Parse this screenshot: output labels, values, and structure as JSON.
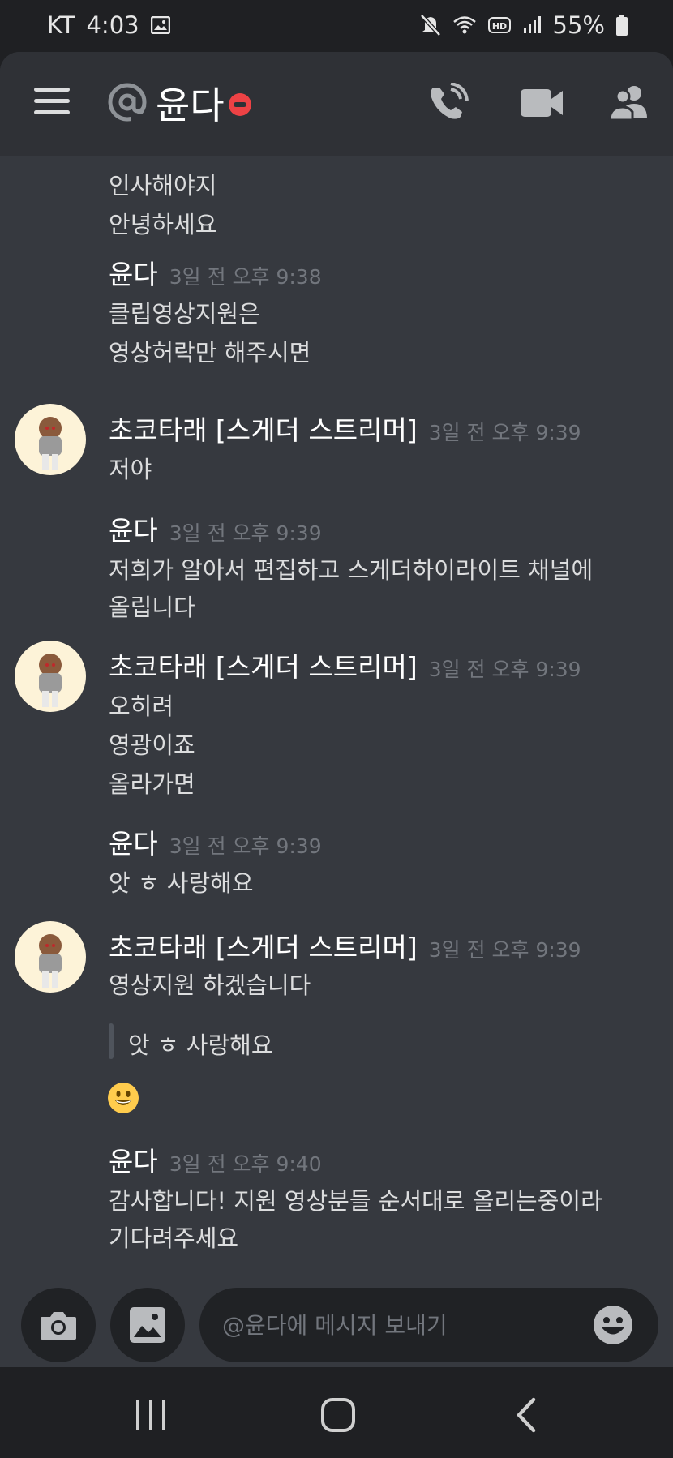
{
  "status_bar": {
    "carrier": "KT",
    "time": "4:03",
    "battery": "55%",
    "icons": [
      "image-icon",
      "mute-icon",
      "wifi-icon",
      "hd-icon",
      "signal-icon",
      "battery-icon"
    ]
  },
  "header": {
    "title": "윤다",
    "icons": [
      "hamburger-icon",
      "at-icon",
      "dnd-status-icon",
      "phone-icon",
      "video-icon",
      "members-icon"
    ]
  },
  "messages": [
    {
      "type": "cont",
      "lines": [
        "인사해야지",
        "안녕하세요"
      ]
    },
    {
      "type": "group",
      "author": "윤다",
      "timestamp": "3일 전 오후 9:38",
      "lines": [
        "클립영상지원은",
        "영상허락만 해주시면"
      ]
    },
    {
      "type": "group",
      "author": "초코타래 [스게더 스트리머]",
      "timestamp": "3일 전 오후 9:39",
      "lines": [
        "저야"
      ]
    },
    {
      "type": "group",
      "author": "윤다",
      "timestamp": "3일 전 오후 9:39",
      "lines": [
        "저희가 알아서 편집하고 스게더하이라이트 채널에",
        "올립니다"
      ]
    },
    {
      "type": "group",
      "author": "초코타래 [스게더 스트리머]",
      "timestamp": "3일 전 오후 9:39",
      "lines": [
        "오히려",
        "영광이죠",
        "올라가면"
      ]
    },
    {
      "type": "group",
      "author": "윤다",
      "timestamp": "3일 전 오후 9:39",
      "lines": [
        "앗 ㅎ 사랑해요"
      ]
    },
    {
      "type": "group",
      "author": "초코타래 [스게더 스트리머]",
      "timestamp": "3일 전 오후 9:39",
      "lines": [
        "영상지원 하겠습니다"
      ],
      "quote": "앗 ㅎ 사랑해요",
      "emoji": "grinning-face-icon"
    },
    {
      "type": "group",
      "author": "윤다",
      "timestamp": "3일 전 오후 9:40",
      "lines": [
        "감사합니다! 지원 영상분들 순서대로 올리는중이라",
        "기다려주세요"
      ]
    }
  ],
  "input": {
    "placeholder": "@윤다에 메시지 보내기"
  },
  "navbar": {
    "icons": [
      "recent-apps-icon",
      "home-icon",
      "back-icon"
    ]
  },
  "colors": {
    "background": "#36393f",
    "header": "#2f3136",
    "input": "#202225",
    "timestamp": "#72767d",
    "dnd": "#ed4245"
  }
}
